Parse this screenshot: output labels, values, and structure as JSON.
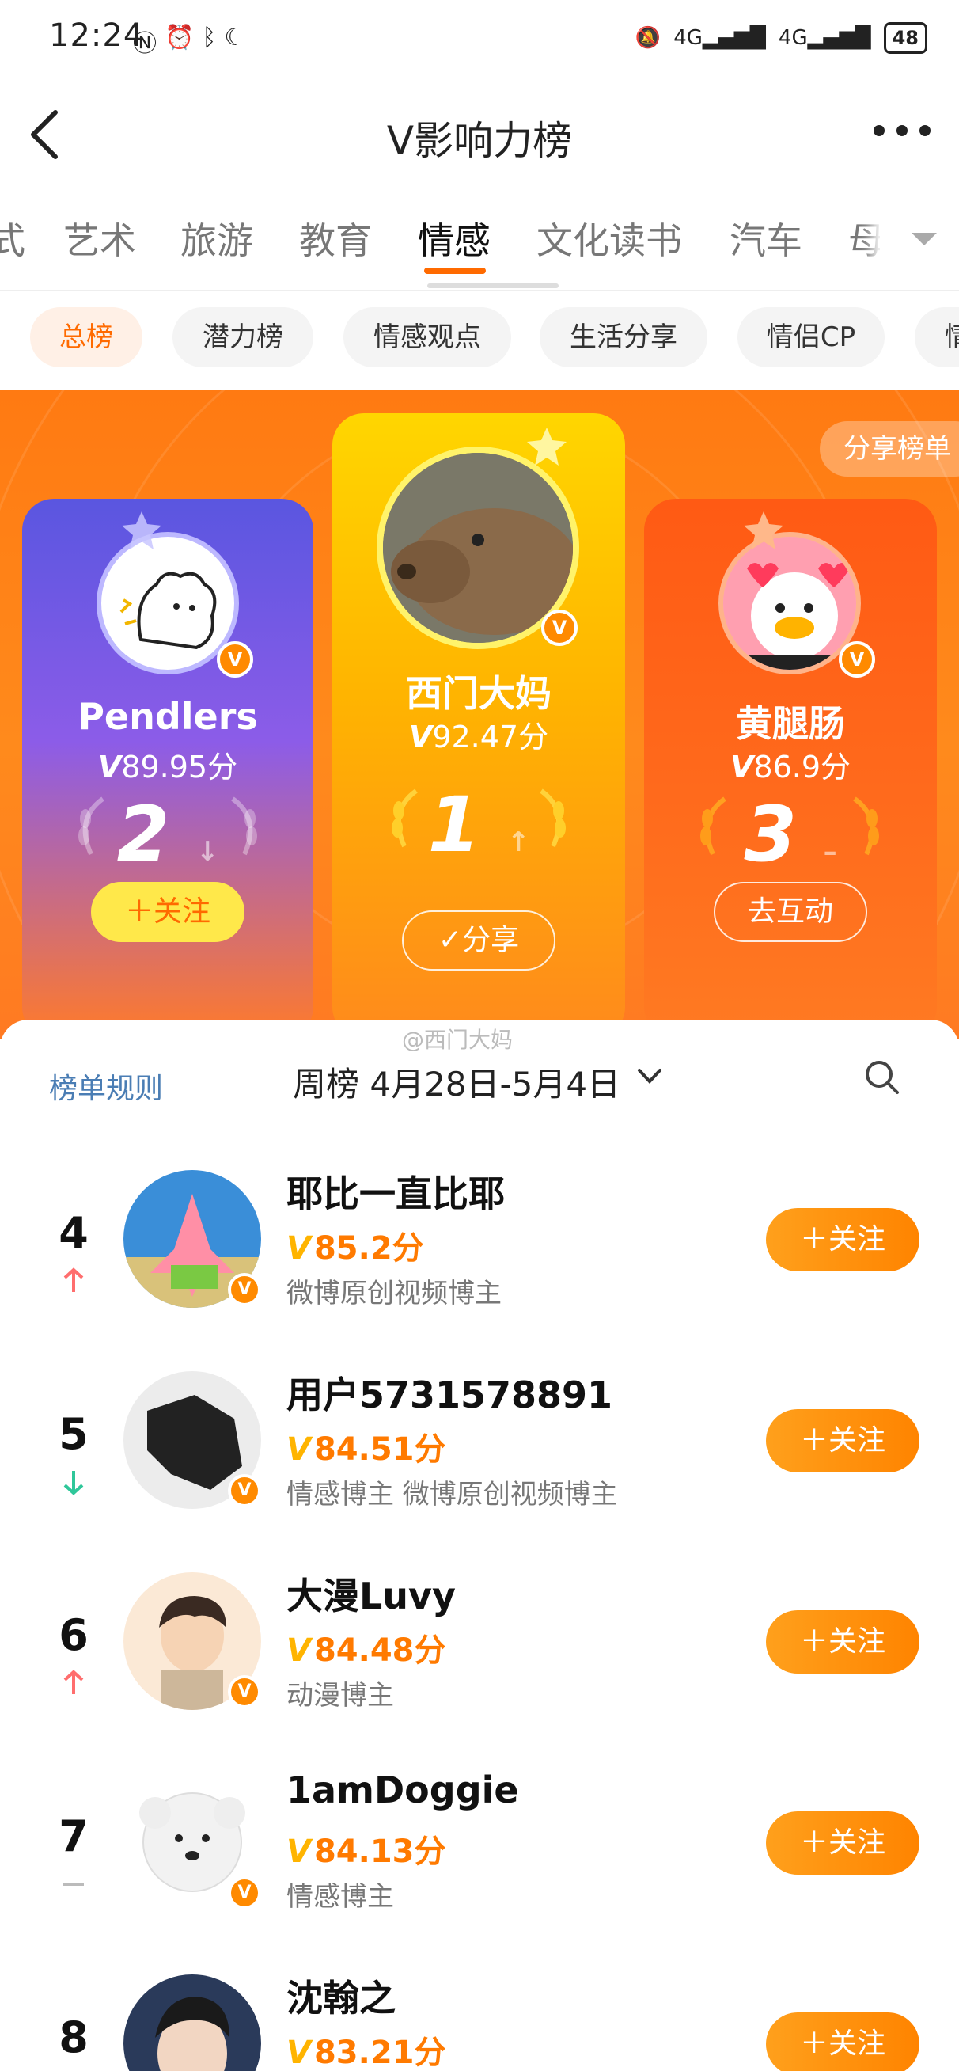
{
  "status_bar": {
    "time": "12:24",
    "left_icons": [
      "nfc-icon",
      "alarm-icon",
      "bluetooth-icon",
      "moon-icon"
    ],
    "right_icons": [
      "mute-icon",
      "4g-signal-icon",
      "4g-signal-icon"
    ],
    "network_1": "4G",
    "network_2": "4G",
    "battery": "48"
  },
  "header": {
    "title": "V影响力榜"
  },
  "category_tabs": [
    "式",
    "艺术",
    "旅游",
    "教育",
    "情感",
    "文化读书",
    "汽车",
    "母"
  ],
  "category_active": "情感",
  "sub_tabs": [
    "总榜",
    "潜力榜",
    "情感观点",
    "生活分享",
    "情侣CP",
    "情"
  ],
  "sub_active": "总榜",
  "hero": {
    "share_label": "分享榜单",
    "podium": [
      {
        "rank": "2",
        "name": "Pendlers",
        "score": "89.95分",
        "action": "＋关注",
        "trend": "down"
      },
      {
        "rank": "1",
        "name": "西门大妈",
        "score": "92.47分",
        "action": "✓分享",
        "trend": "up"
      },
      {
        "rank": "3",
        "name": "黄腿肠",
        "score": "86.9分",
        "action": "去互动",
        "trend": "same"
      }
    ]
  },
  "list": {
    "watermark": "@西门大妈",
    "rules_label": "榜单规则",
    "period_label": "周榜 4月28日-5月4日",
    "rows": [
      {
        "rank": "4",
        "name": "耶比一直比耶",
        "score": "85.2分",
        "desc": "微博原创视频博主",
        "follow": "＋关注",
        "trend": "up"
      },
      {
        "rank": "5",
        "name": "用户5731578891",
        "score": "84.51分",
        "desc": "情感博主 微博原创视频博主",
        "follow": "＋关注",
        "trend": "down"
      },
      {
        "rank": "6",
        "name": "大漫Luvy",
        "score": "84.48分",
        "desc": "动漫博主",
        "follow": "＋关注",
        "trend": "up"
      },
      {
        "rank": "7",
        "name": "1amDoggie",
        "score": "84.13分",
        "desc": "情感博主",
        "follow": "＋关注",
        "trend": "same"
      },
      {
        "rank": "8",
        "name": "沈翰之",
        "score": "83.21分",
        "desc": "",
        "follow": "＋关注",
        "trend": "none"
      }
    ]
  },
  "colors": {
    "accent": "#ff6a00",
    "score": "#ff7a00",
    "up": "#ff5a5a",
    "down": "#2fc79a",
    "link": "#4a7db4"
  }
}
